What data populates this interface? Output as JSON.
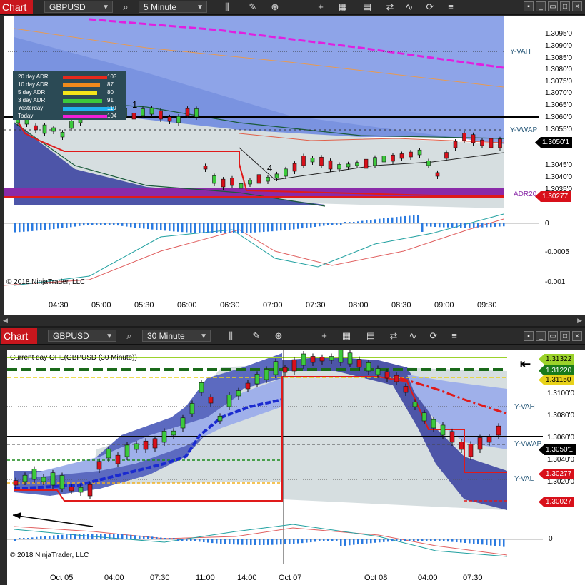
{
  "top": {
    "tab": "Chart",
    "instrument": "GBPUSD",
    "timeframe": "5 Minute",
    "price_ticks": [
      "1.3095'0",
      "1.3090'0",
      "1.3085'0",
      "1.3080'0",
      "1.3075'0",
      "1.3070'0",
      "1.3065'0",
      "1.3060'0",
      "1.3055'0",
      "1.3045'0",
      "1.3040'0",
      "1.3035'0"
    ],
    "last_price": "1.3050'1",
    "adr_marker": "1.30277",
    "osc_ticks": [
      "0",
      "-0.0005",
      "-0.001"
    ],
    "time_ticks": [
      "04:30",
      "05:00",
      "05:30",
      "06:00",
      "06:30",
      "07:00",
      "07:30",
      "08:00",
      "08:30",
      "09:00",
      "09:30"
    ],
    "labels": {
      "yvah": "Y-VAH",
      "yvwap": "Y-VWAP",
      "adr": "ADR20",
      "n1": "1",
      "n4": "4"
    },
    "copyright": "© 2018 NinjaTrader, LLC",
    "adr_panel": [
      {
        "label": "20 day ADR",
        "value": "103",
        "color": "#e8291c"
      },
      {
        "label": "10 day ADR",
        "value": "87",
        "color": "#f08a1c"
      },
      {
        "label": "5 day ADR",
        "value": "80",
        "color": "#f5e51a"
      },
      {
        "label": "3 day ADR",
        "value": "91",
        "color": "#3cc93c"
      },
      {
        "label": "Yesterday",
        "value": "119",
        "color": "#1fb2f0"
      },
      {
        "label": "Today",
        "value": "104",
        "color": "#f01fd8"
      }
    ]
  },
  "bottom": {
    "tab": "Chart",
    "instrument": "GBPUSD",
    "timeframe": "30 Minute",
    "title": "Current day OHL(GBPUSD (30 Minute))",
    "price_ticks": [
      "1.3100'0",
      "1.3080'0",
      "1.3060'0",
      "1.3040'0",
      "1.3020'0"
    ],
    "markers": [
      {
        "text": "1.31322",
        "bg": "#9bd22a",
        "fg": "#000"
      },
      {
        "text": "1.31220",
        "bg": "#1a7a1a",
        "fg": "#fff"
      },
      {
        "text": "1.31150",
        "bg": "#e8d21a",
        "fg": "#000"
      },
      {
        "text": "1.3050'1",
        "bg": "#000",
        "fg": "#fff"
      },
      {
        "text": "1.30277",
        "bg": "#d8101a",
        "fg": "#fff"
      },
      {
        "text": "1.30027",
        "bg": "#d8101a",
        "fg": "#fff"
      }
    ],
    "labels": {
      "yvah": "Y-VAH",
      "yvwap": "Y-VWAP",
      "yval": "Y-VAL"
    },
    "osc_ticks": [
      "0"
    ],
    "time_ticks": [
      "Oct 05",
      "04:00",
      "07:30",
      "11:00",
      "14:00",
      "Oct 07",
      "Oct 08",
      "04:00",
      "07:30"
    ],
    "copyright": "© 2018 NinjaTrader, LLC"
  },
  "toolbar_icons": [
    "search-icon",
    "bar-type-icon",
    "pencil-icon",
    "zoom-in-icon",
    "crosshair-icon",
    "zoom-out-icon",
    "data-box-icon",
    "templates-icon",
    "strategies-icon",
    "indicators-icon",
    "reload-icon"
  ]
}
